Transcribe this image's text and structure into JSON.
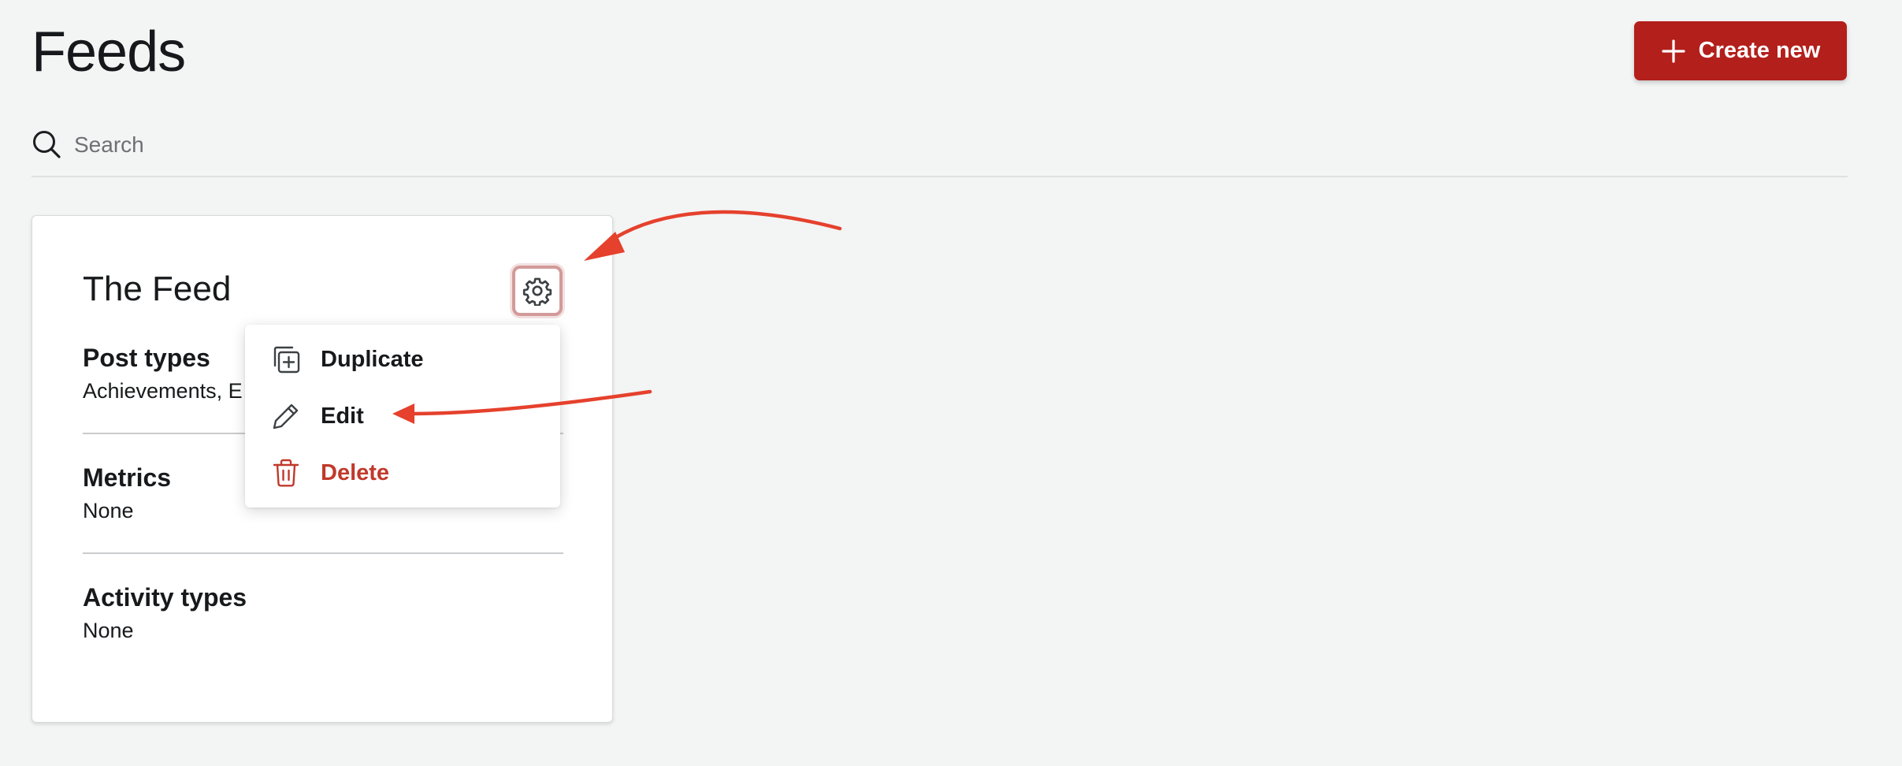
{
  "page": {
    "title": "Feeds",
    "create_label": "Create new"
  },
  "search": {
    "placeholder": "Search",
    "value": ""
  },
  "card": {
    "title": "The Feed",
    "sections": [
      {
        "label": "Post types",
        "value": "Achievements, E"
      },
      {
        "label": "Metrics",
        "value": "None"
      },
      {
        "label": "Activity types",
        "value": "None"
      }
    ]
  },
  "menu": {
    "items": [
      {
        "label": "Duplicate",
        "icon": "duplicate-icon"
      },
      {
        "label": "Edit",
        "icon": "pencil-icon"
      },
      {
        "label": "Delete",
        "icon": "trash-icon"
      }
    ]
  },
  "colors": {
    "primary": "#b31f1b",
    "danger": "#c0392b",
    "annotation": "#e5412d",
    "background": "#f3f4f4"
  }
}
